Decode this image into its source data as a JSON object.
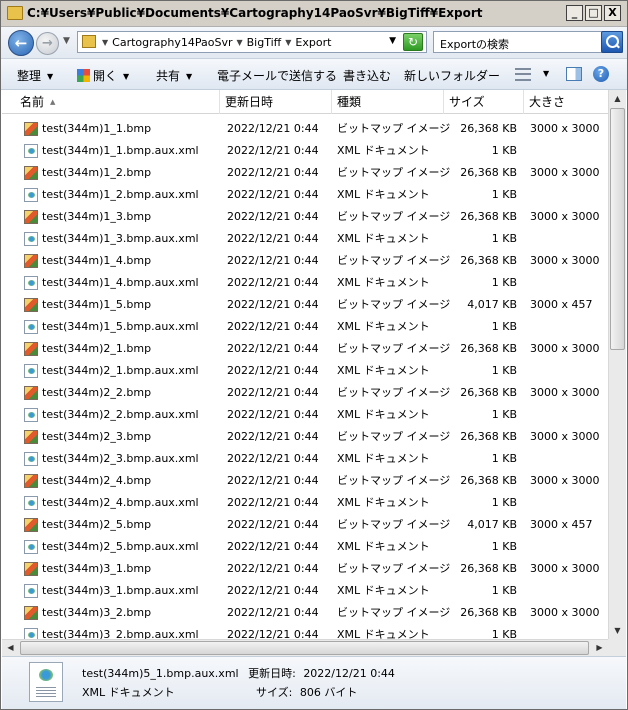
{
  "window": {
    "title": "C:¥Users¥Public¥Documents¥Cartography14PaoSvr¥BigTiff¥Export",
    "minimize": "_",
    "maximize": "□",
    "close": "X"
  },
  "address": {
    "crumbs": [
      "Cartography14PaoSvr",
      "BigTiff",
      "Export"
    ],
    "search_placeholder": "Exportの検索"
  },
  "toolbar": {
    "organize": "整理",
    "open": "開く",
    "share": "共有",
    "email": "電子メールで送信する",
    "burn": "書き込む",
    "new_folder": "新しいフォルダー"
  },
  "columns": {
    "name": "名前",
    "modified": "更新日時",
    "type": "種類",
    "size": "サイズ",
    "dimensions": "大きさ"
  },
  "files": [
    {
      "name": "test(344m)1_1.bmp",
      "date": "2022/12/21 0:44",
      "type": "ビットマップ イメージ",
      "size": "26,368 KB",
      "dim": "3000 x 3000",
      "icon": "bitmap-icon"
    },
    {
      "name": "test(344m)1_1.bmp.aux.xml",
      "date": "2022/12/21 0:44",
      "type": "XML ドキュメント",
      "size": "1 KB",
      "dim": "",
      "icon": "xml-icon"
    },
    {
      "name": "test(344m)1_2.bmp",
      "date": "2022/12/21 0:44",
      "type": "ビットマップ イメージ",
      "size": "26,368 KB",
      "dim": "3000 x 3000",
      "icon": "bitmap-icon"
    },
    {
      "name": "test(344m)1_2.bmp.aux.xml",
      "date": "2022/12/21 0:44",
      "type": "XML ドキュメント",
      "size": "1 KB",
      "dim": "",
      "icon": "xml-icon"
    },
    {
      "name": "test(344m)1_3.bmp",
      "date": "2022/12/21 0:44",
      "type": "ビットマップ イメージ",
      "size": "26,368 KB",
      "dim": "3000 x 3000",
      "icon": "bitmap-icon"
    },
    {
      "name": "test(344m)1_3.bmp.aux.xml",
      "date": "2022/12/21 0:44",
      "type": "XML ドキュメント",
      "size": "1 KB",
      "dim": "",
      "icon": "xml-icon"
    },
    {
      "name": "test(344m)1_4.bmp",
      "date": "2022/12/21 0:44",
      "type": "ビットマップ イメージ",
      "size": "26,368 KB",
      "dim": "3000 x 3000",
      "icon": "bitmap-icon"
    },
    {
      "name": "test(344m)1_4.bmp.aux.xml",
      "date": "2022/12/21 0:44",
      "type": "XML ドキュメント",
      "size": "1 KB",
      "dim": "",
      "icon": "xml-icon"
    },
    {
      "name": "test(344m)1_5.bmp",
      "date": "2022/12/21 0:44",
      "type": "ビットマップ イメージ",
      "size": "4,017 KB",
      "dim": "3000 x 457",
      "icon": "bitmap-icon"
    },
    {
      "name": "test(344m)1_5.bmp.aux.xml",
      "date": "2022/12/21 0:44",
      "type": "XML ドキュメント",
      "size": "1 KB",
      "dim": "",
      "icon": "xml-icon"
    },
    {
      "name": "test(344m)2_1.bmp",
      "date": "2022/12/21 0:44",
      "type": "ビットマップ イメージ",
      "size": "26,368 KB",
      "dim": "3000 x 3000",
      "icon": "bitmap-icon"
    },
    {
      "name": "test(344m)2_1.bmp.aux.xml",
      "date": "2022/12/21 0:44",
      "type": "XML ドキュメント",
      "size": "1 KB",
      "dim": "",
      "icon": "xml-icon"
    },
    {
      "name": "test(344m)2_2.bmp",
      "date": "2022/12/21 0:44",
      "type": "ビットマップ イメージ",
      "size": "26,368 KB",
      "dim": "3000 x 3000",
      "icon": "bitmap-icon"
    },
    {
      "name": "test(344m)2_2.bmp.aux.xml",
      "date": "2022/12/21 0:44",
      "type": "XML ドキュメント",
      "size": "1 KB",
      "dim": "",
      "icon": "xml-icon"
    },
    {
      "name": "test(344m)2_3.bmp",
      "date": "2022/12/21 0:44",
      "type": "ビットマップ イメージ",
      "size": "26,368 KB",
      "dim": "3000 x 3000",
      "icon": "bitmap-icon"
    },
    {
      "name": "test(344m)2_3.bmp.aux.xml",
      "date": "2022/12/21 0:44",
      "type": "XML ドキュメント",
      "size": "1 KB",
      "dim": "",
      "icon": "xml-icon"
    },
    {
      "name": "test(344m)2_4.bmp",
      "date": "2022/12/21 0:44",
      "type": "ビットマップ イメージ",
      "size": "26,368 KB",
      "dim": "3000 x 3000",
      "icon": "bitmap-icon"
    },
    {
      "name": "test(344m)2_4.bmp.aux.xml",
      "date": "2022/12/21 0:44",
      "type": "XML ドキュメント",
      "size": "1 KB",
      "dim": "",
      "icon": "xml-icon"
    },
    {
      "name": "test(344m)2_5.bmp",
      "date": "2022/12/21 0:44",
      "type": "ビットマップ イメージ",
      "size": "4,017 KB",
      "dim": "3000 x 457",
      "icon": "bitmap-icon"
    },
    {
      "name": "test(344m)2_5.bmp.aux.xml",
      "date": "2022/12/21 0:44",
      "type": "XML ドキュメント",
      "size": "1 KB",
      "dim": "",
      "icon": "xml-icon"
    },
    {
      "name": "test(344m)3_1.bmp",
      "date": "2022/12/21 0:44",
      "type": "ビットマップ イメージ",
      "size": "26,368 KB",
      "dim": "3000 x 3000",
      "icon": "bitmap-icon"
    },
    {
      "name": "test(344m)3_1.bmp.aux.xml",
      "date": "2022/12/21 0:44",
      "type": "XML ドキュメント",
      "size": "1 KB",
      "dim": "",
      "icon": "xml-icon"
    },
    {
      "name": "test(344m)3_2.bmp",
      "date": "2022/12/21 0:44",
      "type": "ビットマップ イメージ",
      "size": "26,368 KB",
      "dim": "3000 x 3000",
      "icon": "bitmap-icon"
    },
    {
      "name": "test(344m)3_2.bmp.aux.xml",
      "date": "2022/12/21 0:44",
      "type": "XML ドキュメント",
      "size": "1 KB",
      "dim": "",
      "icon": "xml-icon"
    }
  ],
  "details": {
    "name": "test(344m)5_1.bmp.aux.xml",
    "modified_label": "更新日時:",
    "modified_value": "2022/12/21 0:44",
    "type": "XML ドキュメント",
    "size_label": "サイズ:",
    "size_value": "806 バイト"
  }
}
